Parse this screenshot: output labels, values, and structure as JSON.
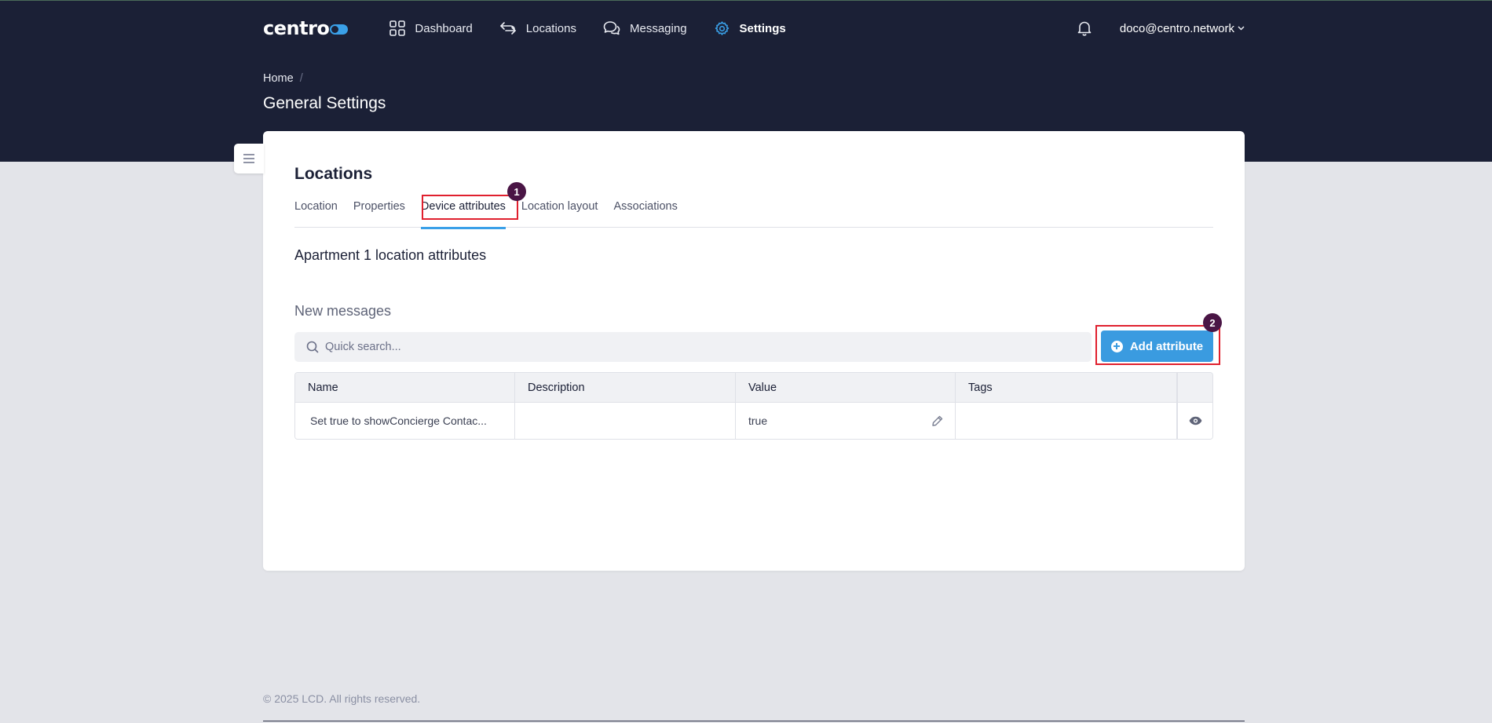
{
  "app": {
    "logo_text": "centro",
    "accent_color": "#3aa0e8",
    "header_bg": "#1b2036",
    "annotation_color": "#e0202e",
    "badge_color": "#4a1545"
  },
  "nav": {
    "items": [
      {
        "label": "Dashboard",
        "icon": "grid-icon"
      },
      {
        "label": "Locations",
        "icon": "arrows-exchange-icon"
      },
      {
        "label": "Messaging",
        "icon": "chat-bubbles-icon"
      },
      {
        "label": "Settings",
        "icon": "gear-icon",
        "active": true
      }
    ],
    "user_email": "doco@centro.network",
    "bell_icon": "bell-icon"
  },
  "breadcrumb": {
    "home": "Home",
    "separator": "/"
  },
  "page": {
    "title": "General Settings"
  },
  "card": {
    "title": "Locations",
    "tabs": [
      {
        "label": "Location"
      },
      {
        "label": "Properties"
      },
      {
        "label": "Device attributes",
        "active": true
      },
      {
        "label": "Location layout"
      },
      {
        "label": "Associations"
      }
    ],
    "subheading": "Apartment 1 location attributes",
    "section_label": "New messages",
    "search": {
      "placeholder": "Quick search...",
      "value": ""
    },
    "add_button_label": "Add attribute",
    "table": {
      "headers": [
        "Name",
        "Description",
        "Value",
        "Tags",
        ""
      ],
      "rows": [
        {
          "name": "Set true to showConcierge Contac...",
          "description": "",
          "value": "true",
          "tags": ""
        }
      ]
    }
  },
  "annotations": [
    {
      "label": "1"
    },
    {
      "label": "2"
    }
  ],
  "footer": {
    "text": "© 2025 LCD. All rights reserved."
  }
}
